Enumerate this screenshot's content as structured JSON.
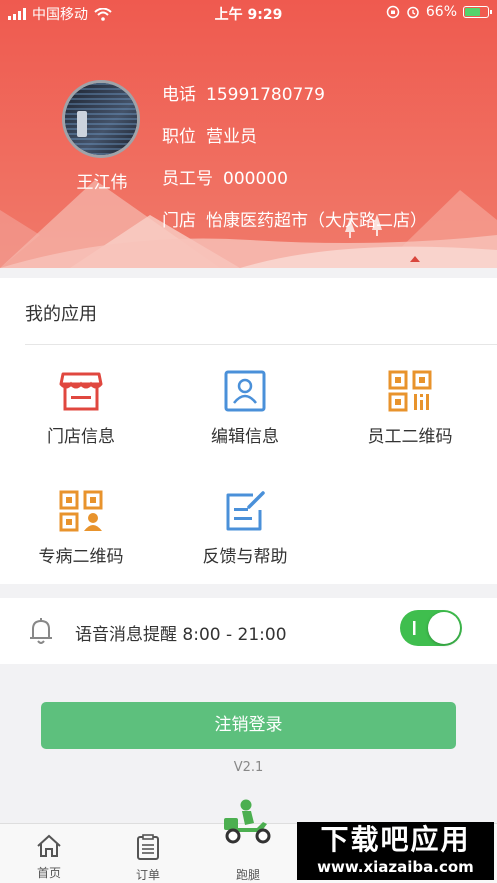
{
  "status_bar": {
    "carrier": "中国移动",
    "time": "上午 9:29",
    "battery": "66%",
    "battery_level": 0.66
  },
  "profile": {
    "name": "王江伟",
    "phone_label": "电话",
    "phone": "15991780779",
    "position_label": "职位",
    "position": "营业员",
    "employee_id_label": "员工号",
    "employee_id": "000000",
    "store_label": "门店",
    "store": "怡康医药超市（大庆路二店）"
  },
  "apps": {
    "title": "我的应用",
    "items": [
      {
        "label": "门店信息",
        "icon": "store-icon"
      },
      {
        "label": "编辑信息",
        "icon": "profile-card-icon"
      },
      {
        "label": "员工二维码",
        "icon": "qr-code-icon"
      },
      {
        "label": "专病二维码",
        "icon": "qr-code-person-icon"
      },
      {
        "label": "反馈与帮助",
        "icon": "feedback-edit-icon"
      }
    ]
  },
  "reminder": {
    "label": "语音消息提醒 8:00 - 21:00",
    "enabled": true
  },
  "logout_label": "注销登录",
  "version": "V2.1",
  "tabs": [
    {
      "label": "首页",
      "icon": "home-icon"
    },
    {
      "label": "订单",
      "icon": "clipboard-icon"
    },
    {
      "label": "跑腿",
      "icon": "delivery-rider-icon"
    }
  ],
  "watermark": {
    "title": "下载吧应用",
    "url": "www.xiazaiba.com"
  },
  "colors": {
    "header_red": "#ef5a4f",
    "app_red": "#e0473f",
    "app_blue": "#4a90d9",
    "app_orange": "#e8932c",
    "toggle_green": "#3fbe4e",
    "button_green": "#5dc07d"
  }
}
